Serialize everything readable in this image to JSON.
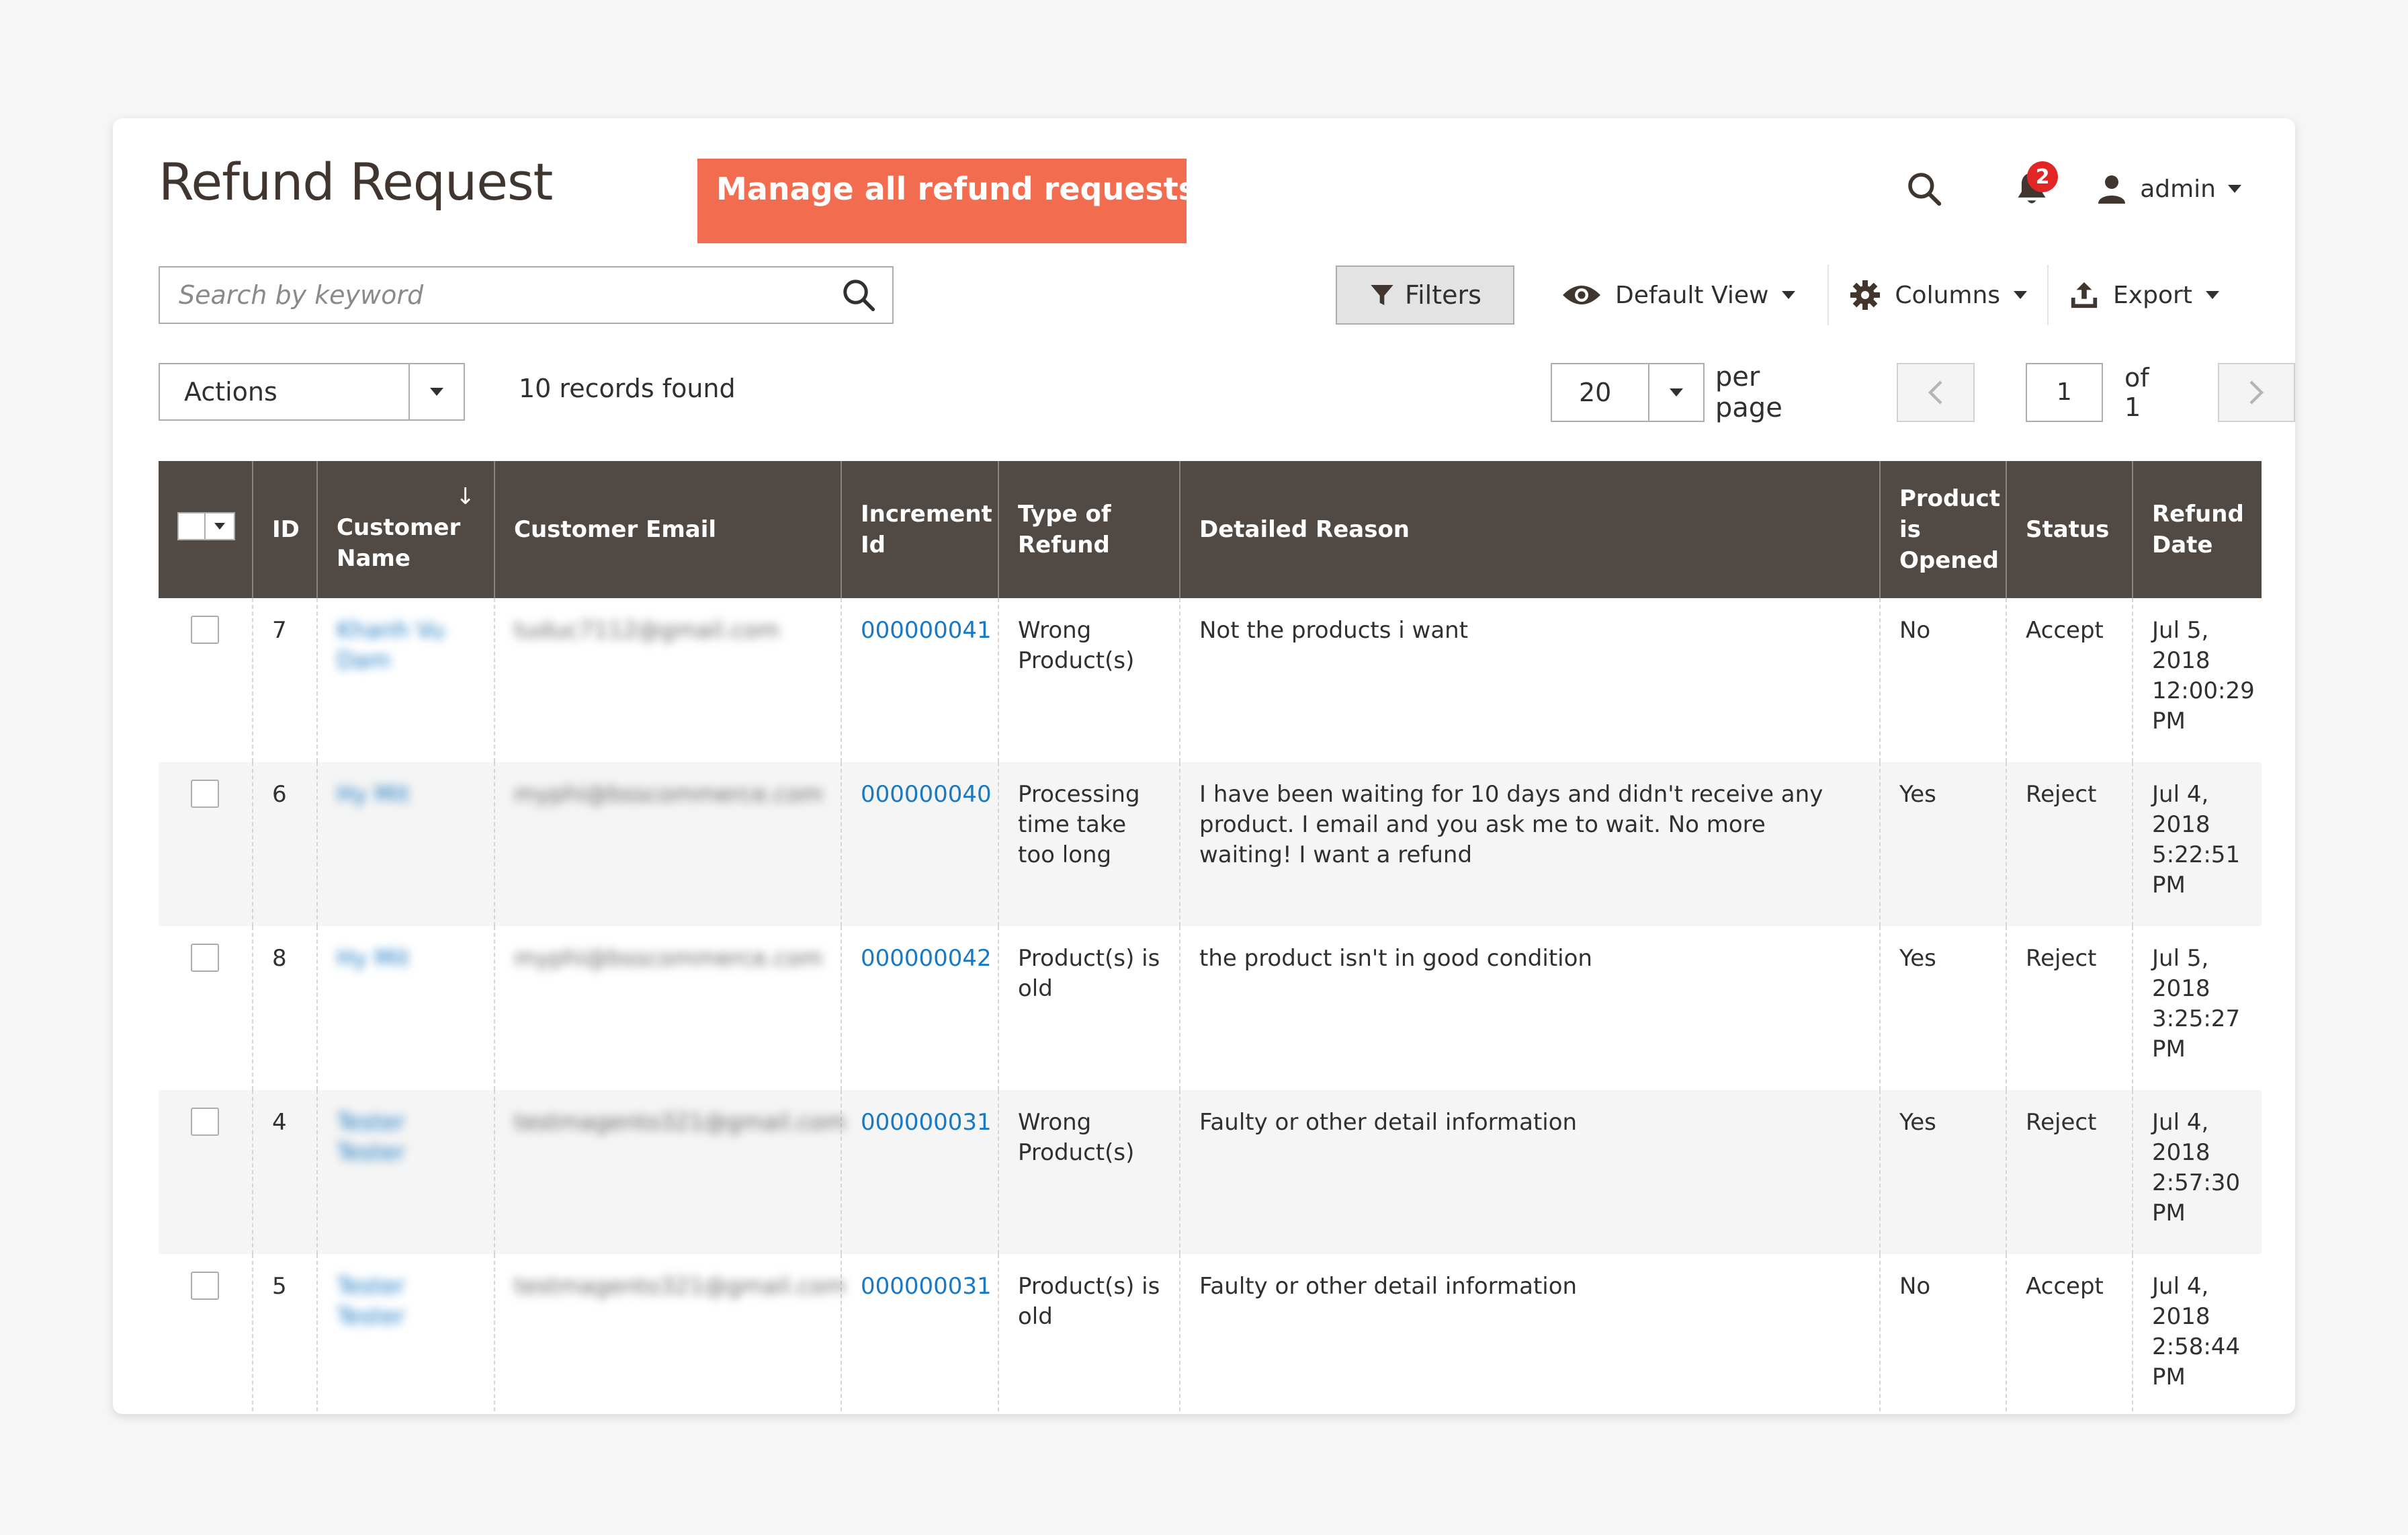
{
  "page": {
    "title": "Refund Request",
    "banner": "Manage all refund requests"
  },
  "header": {
    "notifications_count": "2",
    "user": "admin"
  },
  "search": {
    "placeholder": "Search by keyword"
  },
  "toolbar": {
    "filters_label": "Filters",
    "view_label": "Default View",
    "columns_label": "Columns",
    "export_label": "Export"
  },
  "actions": {
    "label": "Actions",
    "records_found": "10 records found"
  },
  "pagination": {
    "per_page_value": "20",
    "per_page_label": "per page",
    "current_page": "1",
    "of_label": "of 1"
  },
  "table": {
    "headers": {
      "id": "ID",
      "customer_name": "Customer Name",
      "customer_email": "Customer Email",
      "increment_id": "Increment Id",
      "type_of_refund": "Type of Refund",
      "detailed_reason": "Detailed Reason",
      "product_opened": "Product is Opened",
      "status": "Status",
      "refund_date": "Refund Date"
    },
    "rows": [
      {
        "id": "7",
        "customer_name": "Khanh Vu Dam",
        "customer_email": "tuduc7112@gmail.com",
        "increment_id": "000000041",
        "type": "Wrong Product(s)",
        "reason": "Not the products i want",
        "opened": "No",
        "status": "Accept",
        "date": "Jul 5, 2018 12:00:29 PM"
      },
      {
        "id": "6",
        "customer_name": "Hy Mit",
        "customer_email": "myphi@bsscommerce.com",
        "increment_id": "000000040",
        "type": "Processing time take too long",
        "reason": "I have been waiting for 10 days and didn't receive any product. I email and you ask me to wait. No more waiting! I want a refund",
        "opened": "Yes",
        "status": "Reject",
        "date": "Jul 4, 2018 5:22:51 PM"
      },
      {
        "id": "8",
        "customer_name": "Hy Mit",
        "customer_email": "myphi@bsscommerce.com",
        "increment_id": "000000042",
        "type": "Product(s) is old",
        "reason": "the product isn't in good condition",
        "opened": "Yes",
        "status": "Reject",
        "date": "Jul 5, 2018 3:25:27 PM"
      },
      {
        "id": "4",
        "customer_name": "Tester Tester",
        "customer_email": "testmagento321@gmail.com",
        "increment_id": "000000031",
        "type": "Wrong Product(s)",
        "reason": "Faulty or other detail information",
        "opened": "Yes",
        "status": "Reject",
        "date": "Jul 4, 2018 2:57:30 PM"
      },
      {
        "id": "5",
        "customer_name": "Tester Tester",
        "customer_email": "testmagento321@gmail.com",
        "increment_id": "000000031",
        "type": "Product(s) is old",
        "reason": "Faulty or other detail information",
        "opened": "No",
        "status": "Accept",
        "date": "Jul 4, 2018 2:58:44 PM"
      }
    ]
  }
}
